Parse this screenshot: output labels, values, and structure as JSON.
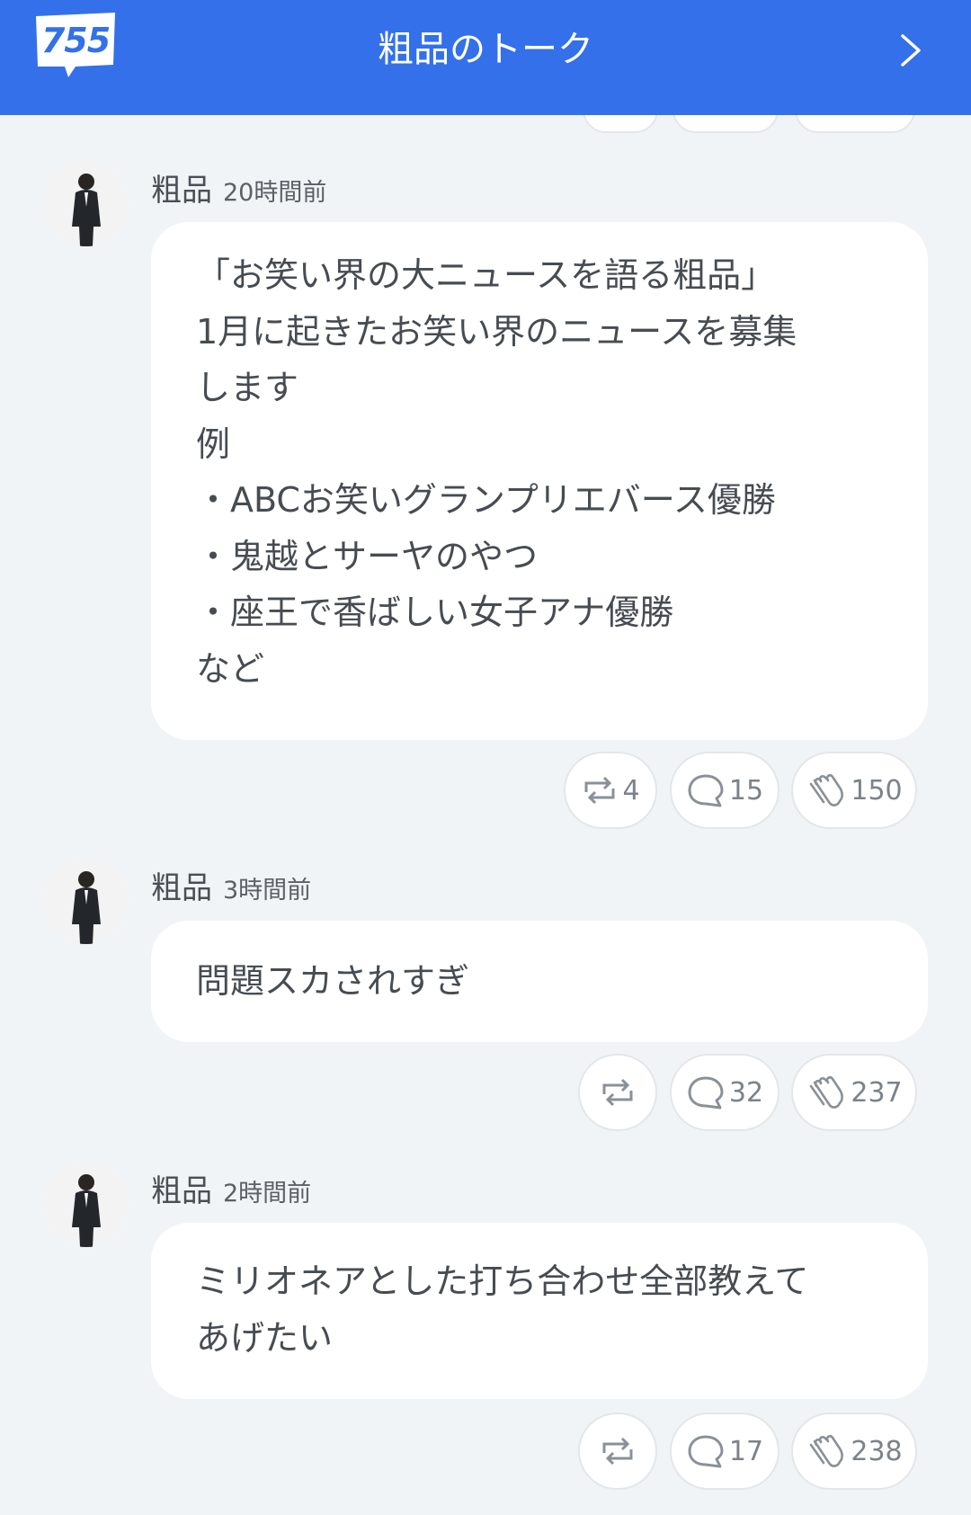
{
  "header": {
    "logo_text": "755",
    "title": "粗品のトーク",
    "next_icon": "chevron-right-icon",
    "bg_color": "#3370ea"
  },
  "posts": [
    {
      "author": "粗品",
      "time": "20時間前",
      "text": "「お笑い界の大ニュースを語る粗品」\n1月に起きたお笑い界のニュースを募集\nします\n例\n・ABCお笑いグランプリエバース優勝\n・鬼越とサーヤのやつ\n・座王で香ばしい女子アナ優勝\nなど",
      "repost_count": "4",
      "comment_count": "15",
      "clap_count": "150"
    },
    {
      "author": "粗品",
      "time": "3時間前",
      "text": "問題スカされすぎ",
      "repost_count": "",
      "comment_count": "32",
      "clap_count": "237"
    },
    {
      "author": "粗品",
      "time": "2時間前",
      "text": "ミリオネアとした打ち合わせ全部教えて\nあげたい",
      "repost_count": "",
      "comment_count": "17",
      "clap_count": "238"
    }
  ]
}
